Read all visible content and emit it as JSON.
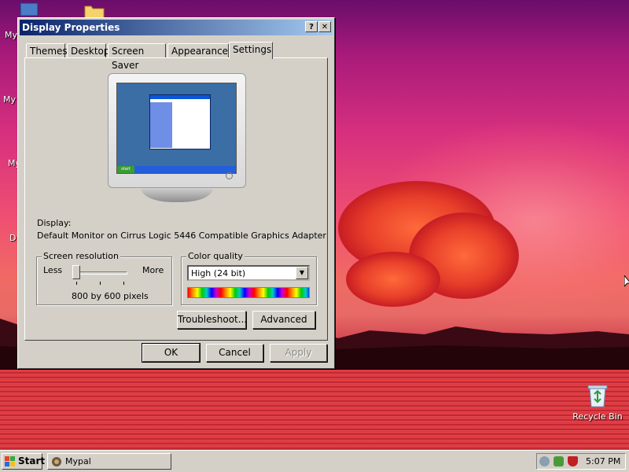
{
  "desktop": {
    "icons": [
      {
        "label": "My"
      },
      {
        "label": "My"
      },
      {
        "label": "My"
      },
      {
        "label": "D"
      }
    ],
    "recycle_bin": "Recycle Bin"
  },
  "window": {
    "title": "Display Properties",
    "help_button": "?",
    "close_button": "✕",
    "tabs": [
      {
        "label": "Themes"
      },
      {
        "label": "Desktop"
      },
      {
        "label": "Screen Saver"
      },
      {
        "label": "Appearance"
      },
      {
        "label": "Settings",
        "active": true
      }
    ],
    "display_label": "Display:",
    "display_value": "Default Monitor on Cirrus Logic 5446 Compatible Graphics Adapter",
    "resolution": {
      "title": "Screen resolution",
      "less": "Less",
      "more": "More",
      "value_text": "800 by 600 pixels",
      "slider_level": 0
    },
    "color_quality": {
      "title": "Color quality",
      "selected": "High (24 bit)"
    },
    "buttons": {
      "troubleshoot": "Troubleshoot...",
      "advanced": "Advanced",
      "ok": "OK",
      "cancel": "Cancel",
      "apply": "Apply"
    },
    "preview_start": "start"
  },
  "taskbar": {
    "start": "Start",
    "task": "Mypal",
    "clock": "5:07 PM"
  },
  "colors": {
    "titlebar_start": "#0a246a",
    "titlebar_end": "#a6caf0",
    "face": "#d4d0c8"
  }
}
